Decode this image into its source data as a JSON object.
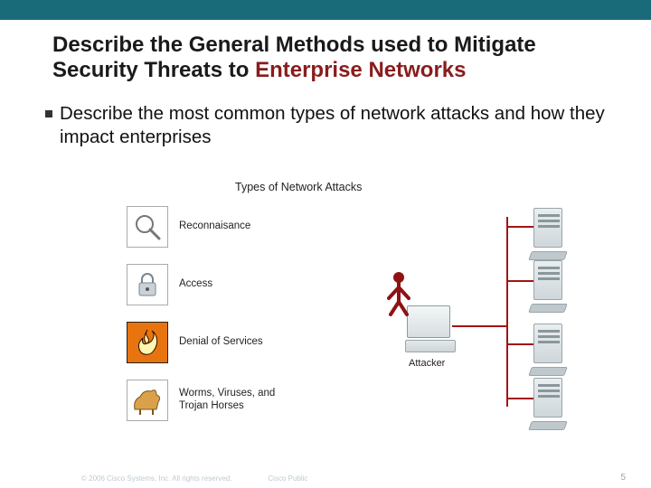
{
  "title_line1": "Describe the General Methods used to Mitigate",
  "title_line2_plain": "Security Threats to ",
  "title_line2_accent": "Enterprise Networks",
  "bullet": "Describe the most common types of network attacks and how they impact enterprises",
  "diagram": {
    "title": "Types of Network Attacks",
    "items": [
      {
        "label": "Reconnaisance"
      },
      {
        "label": "Access"
      },
      {
        "label": "Denial of Services"
      },
      {
        "label": "Worms, Viruses, and Trojan Horses"
      }
    ],
    "attacker_label": "Attacker"
  },
  "footer": {
    "copyright": "© 2006 Cisco Systems, Inc. All rights reserved.",
    "classification": "Cisco Public",
    "page": "5"
  }
}
